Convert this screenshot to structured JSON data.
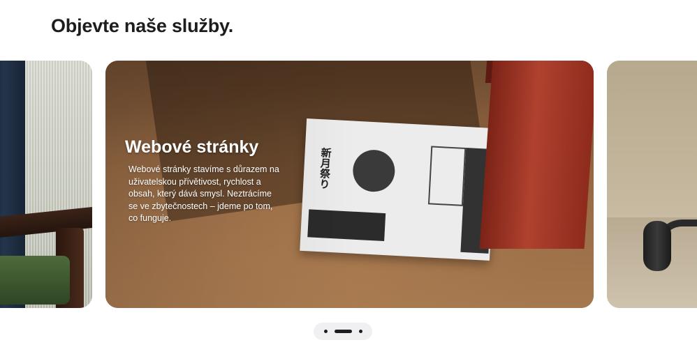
{
  "section": {
    "title": "Objevte naše služby."
  },
  "carousel": {
    "active_card": {
      "title": "Webové stránky",
      "description": "Webové stránky stavíme s důrazem na uživatelskou přívětivost, rychlost a obsah, který dává smysl. Neztrácíme se ve zbytečnostech – jdeme po tom, co funguje."
    },
    "pager": {
      "count": 3,
      "active_index": 1
    }
  }
}
